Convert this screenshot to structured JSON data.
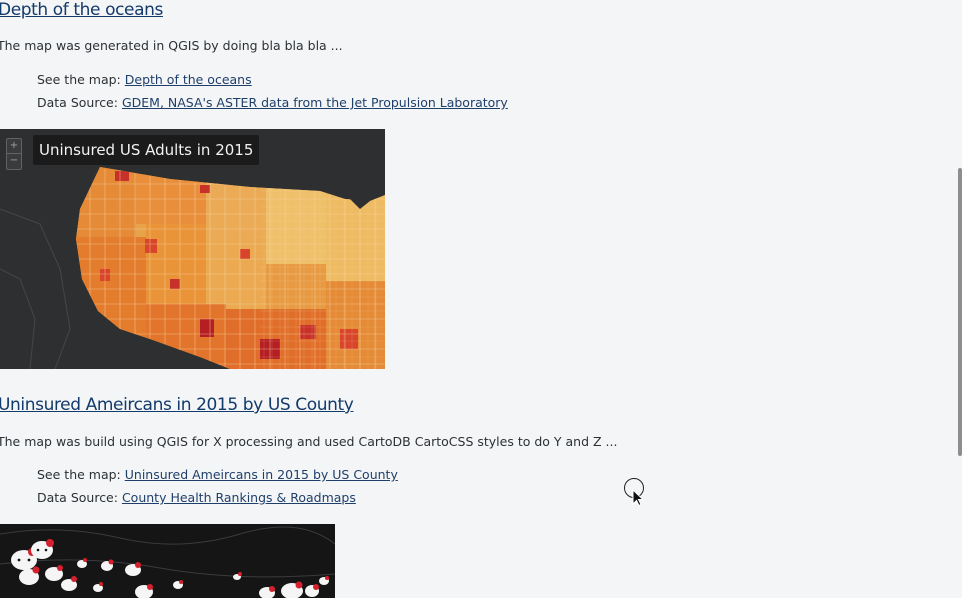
{
  "projects": [
    {
      "title": "Depth of the oceans",
      "description": "The map was generated in QGIS by doing bla bla bla ...",
      "see_map_label": "See the map:",
      "see_map_link": "Depth of the oceans",
      "source_label": "Data Source:",
      "source_link": "GDEM, NASA's ASTER data from the Jet Propulsion Laboratory"
    },
    {
      "map_title": "Uninsured US Adults in 2015",
      "zoom_in": "+",
      "zoom_out": "−",
      "title": "Uninsured Ameircans in 2015 by US County",
      "description": "The map was build using QGIS for X processing and used CartoDB CartoCSS styles to do Y and Z ...",
      "see_map_label": "See the map:",
      "see_map_link": "Uninsured Ameircans in 2015 by US County",
      "source_label": "Data Source:",
      "source_link": "County Health Rankings & Roadmaps"
    }
  ],
  "colors": {
    "link": "#1f3f6b",
    "map_choropleth": [
      "#f0c46a",
      "#eba04a",
      "#e57b2e",
      "#d9452a",
      "#b51f24"
    ],
    "map_background": "#2e2f31"
  },
  "icons": [
    "zoom-in-icon",
    "zoom-out-icon",
    "mouse-cursor-icon",
    "hello-kitty-marker-icon"
  ]
}
